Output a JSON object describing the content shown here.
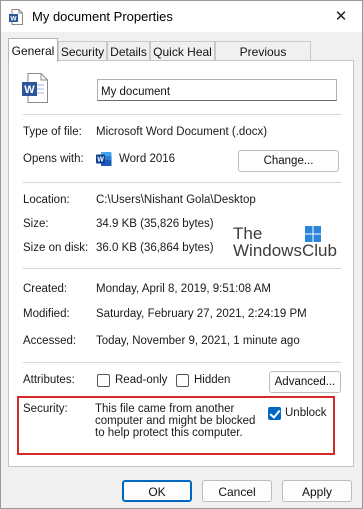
{
  "window": {
    "title": "My document Properties",
    "close_glyph": "✕"
  },
  "tabs": [
    {
      "label": "General",
      "active": true
    },
    {
      "label": "Security"
    },
    {
      "label": "Details"
    },
    {
      "label": "Quick Heal"
    },
    {
      "label": "Previous Versions"
    }
  ],
  "file": {
    "name": "My document",
    "type_label": "Type of file:",
    "type_value": "Microsoft Word Document (.docx)",
    "opens_label": "Opens with:",
    "opens_value": "Word 2016",
    "change_button": "Change..."
  },
  "location": {
    "location_label": "Location:",
    "location_value": "C:\\Users\\Nishant Gola\\Desktop",
    "size_label": "Size:",
    "size_value": "34.9 KB (35,826 bytes)",
    "size_disk_label": "Size on disk:",
    "size_disk_value": "36.0 KB (36,864 bytes)"
  },
  "dates": {
    "created_label": "Created:",
    "created_value": "Monday, April 8, 2019, 9:51:08 AM",
    "modified_label": "Modified:",
    "modified_value": "Saturday, February 27, 2021, 2:24:19 PM",
    "accessed_label": "Accessed:",
    "accessed_value": "Today, November 9, 2021, 1 minute ago"
  },
  "attributes": {
    "label": "Attributes:",
    "readonly_label": "Read-only",
    "readonly_checked": false,
    "hidden_label": "Hidden",
    "hidden_checked": false,
    "advanced_button": "Advanced..."
  },
  "security": {
    "label": "Security:",
    "message": "This file came from another computer and might be blocked to help protect this computer.",
    "unblock_label": "Unblock",
    "unblock_checked": true
  },
  "watermark": {
    "line1": "The",
    "line2": "WindowsClub"
  },
  "footer": {
    "ok": "OK",
    "cancel": "Cancel",
    "apply": "Apply"
  },
  "colors": {
    "accent": "#0067c0",
    "highlight_border": "#d42a2a",
    "word_blue": "#2b579a"
  },
  "icons": {
    "title": "word-document-icon",
    "file": "word-document-icon",
    "opens_with": "word-app-icon",
    "watermark": "windows-logo-icon"
  }
}
